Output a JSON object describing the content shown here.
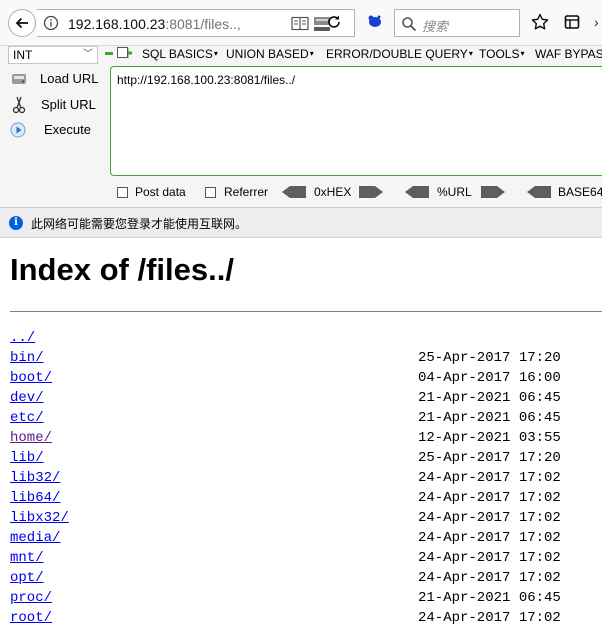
{
  "navbar": {
    "url_host": "192.168.100.23",
    "url_rest": ":8081/files..,",
    "search_placeholder": "搜索"
  },
  "hackbar": {
    "int_value": "INT",
    "menus": [
      "SQL BASICS",
      "UNION BASED",
      "ERROR/DOUBLE QUERY",
      "TOOLS",
      "WAF BYPASS"
    ],
    "load_url_label": "Load URL",
    "split_url_label": "Split URL",
    "execute_label": "Execute",
    "url_value": "http://192.168.100.23:8081/files../",
    "post_data_label": "Post data",
    "referrer_label": "Referrer",
    "hex_label": "0xHEX",
    "url_enc_label": "%URL",
    "base64_label": "BASE64",
    "accent_color": "#3fa535"
  },
  "infobar": {
    "message": "此网络可能需要您登录才能使用互联网。"
  },
  "page": {
    "title": "Index of /files../",
    "entries": [
      {
        "name": "../",
        "date": ""
      },
      {
        "name": "bin/",
        "date": "25-Apr-2017 17:20"
      },
      {
        "name": "boot/",
        "date": "04-Apr-2017 16:00"
      },
      {
        "name": "dev/",
        "date": "21-Apr-2021 06:45"
      },
      {
        "name": "etc/",
        "date": "21-Apr-2021 06:45"
      },
      {
        "name": "home/",
        "date": "12-Apr-2021 03:55"
      },
      {
        "name": "lib/",
        "date": "25-Apr-2017 17:20"
      },
      {
        "name": "lib32/",
        "date": "24-Apr-2017 17:02"
      },
      {
        "name": "lib64/",
        "date": "24-Apr-2017 17:02"
      },
      {
        "name": "libx32/",
        "date": "24-Apr-2017 17:02"
      },
      {
        "name": "media/",
        "date": "24-Apr-2017 17:02"
      },
      {
        "name": "mnt/",
        "date": "24-Apr-2017 17:02"
      },
      {
        "name": "opt/",
        "date": "24-Apr-2017 17:02"
      },
      {
        "name": "proc/",
        "date": "21-Apr-2021 06:45"
      },
      {
        "name": "root/",
        "date": "24-Apr-2017 17:02"
      }
    ]
  }
}
